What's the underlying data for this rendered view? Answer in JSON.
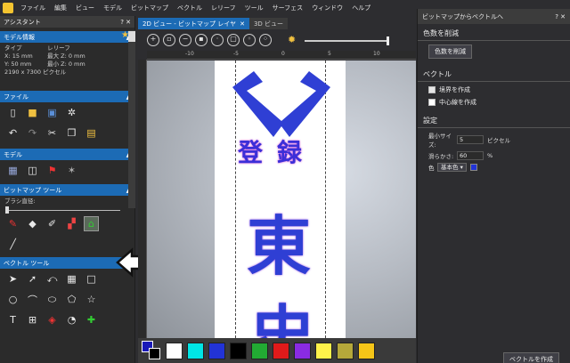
{
  "menubar": {
    "items": [
      "ファイル",
      "編集",
      "ビュー",
      "モデル",
      "ビットマップ",
      "ベクトル",
      "レリーフ",
      "ツール",
      "サーフェス",
      "ウィンドウ",
      "ヘルプ"
    ]
  },
  "left_panel": {
    "title": "アシスタント",
    "title_controls": "? ✕",
    "model_info": {
      "header": "モデル情報",
      "type_label": "タイプ",
      "type_value": "レリーフ",
      "x": "X: 15 mm",
      "y": "Y: 50 mm",
      "zmax": "最大 Z: 0 mm",
      "zmin": "最小 Z: 0 mm",
      "pixels": "2190 x 7300 ピクセル"
    },
    "file_header": "ファイル",
    "model_header": "モデル",
    "bitmap_tools_header": "ビットマップ ツール",
    "brush_label": "ブラシ直径:",
    "vector_tools_header": "ベクトル ツール"
  },
  "doc_tabs": [
    {
      "label": "2D ビュー - ビットマップ レイヤ",
      "active": true
    },
    {
      "label": "3D ビュー",
      "active": false
    }
  ],
  "ruler": {
    "labels": [
      "-15",
      "-10",
      "-5",
      "0",
      "5",
      "10",
      "15"
    ]
  },
  "canvas": {
    "text_top": "登録",
    "text_big_1": "東",
    "text_big_2": "史",
    "emblem_color": "#2f3fd4"
  },
  "palette": {
    "colors": [
      "#1a1ab8",
      "#ffffff",
      "#00e5e5",
      "#2233d6",
      "#000000",
      "#22aa33",
      "#e01a1a",
      "#8a2be2",
      "#fff24a",
      "#b5a83a",
      "#f5c518"
    ]
  },
  "right_panel": {
    "title": "ビットマップからベクトルへ",
    "title_controls": "? ✕",
    "reduce_colors_header": "色数を削減",
    "reduce_colors_button": "色数を削減",
    "vector_header": "ベクトル",
    "create_boundary": "境界を作成",
    "create_centerline": "中心線を作成",
    "settings_header": "設定",
    "min_size_label": "最小サイズ:",
    "min_size_value": "5",
    "min_size_unit": "ピクセル",
    "smoothness_label": "滑らかさ:",
    "smoothness_value": "60",
    "smoothness_unit": "%",
    "color_label": "色",
    "color_value": "基本色",
    "create_vectors_button": "ベクトルを作成"
  }
}
